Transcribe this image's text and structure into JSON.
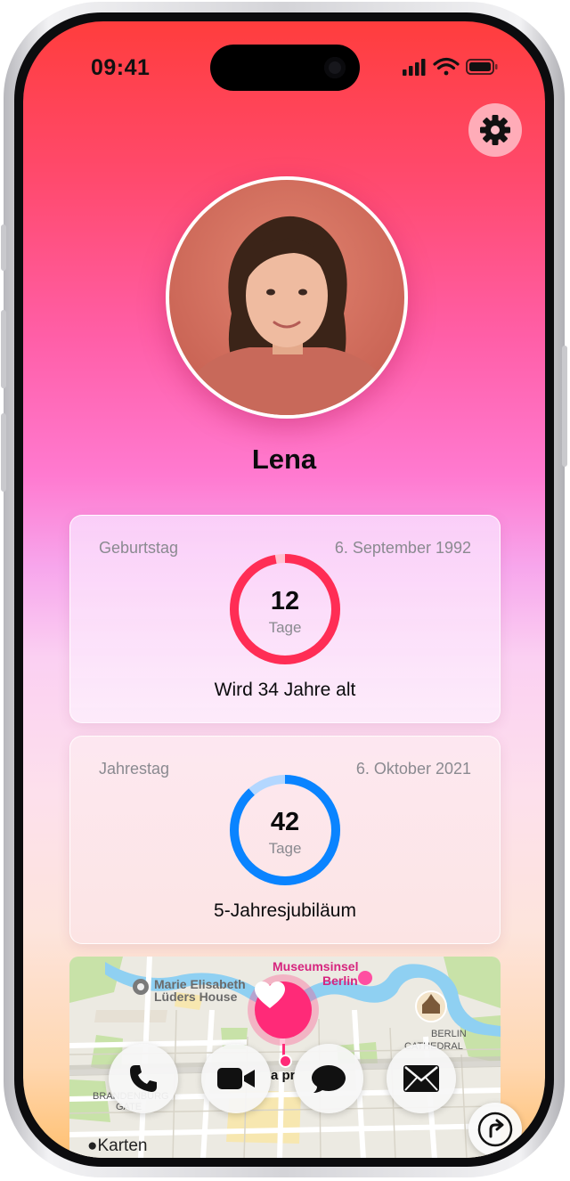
{
  "status_bar": {
    "time": "09:41"
  },
  "profile": {
    "name": "Lena"
  },
  "cards": {
    "birthday": {
      "label": "Geburtstag",
      "date": "6. September 1992",
      "days": "12",
      "unit": "Tage",
      "subtitle": "Wird 34 Jahre alt",
      "ring_color": "#ff2d55",
      "progress": 0.97
    },
    "anniversary": {
      "label": "Jahrestag",
      "date": "6. Oktober 2021",
      "days": "42",
      "unit": "Tage",
      "subtitle": "5-Jahresjubiläum",
      "ring_color": "#0a84ff",
      "progress": 0.885
    }
  },
  "map": {
    "labels": {
      "museum": "Museumsinsel",
      "berlin": "Berlin",
      "house_1": "Marie Elisabeth",
      "house_2": "Lüders House",
      "gate_1": "BRANDENBURG",
      "gate_2": "GATE",
      "cathedral_1": "BERLIN",
      "cathedral_2": "CATHEDRAL",
      "partial": "a pr"
    },
    "attribution": "Karten"
  },
  "actions": [
    "phone-icon",
    "video-icon",
    "message-icon",
    "mail-icon"
  ],
  "colors": {
    "accent": "#ff2a78",
    "gear_bg": "#ffbec8"
  }
}
